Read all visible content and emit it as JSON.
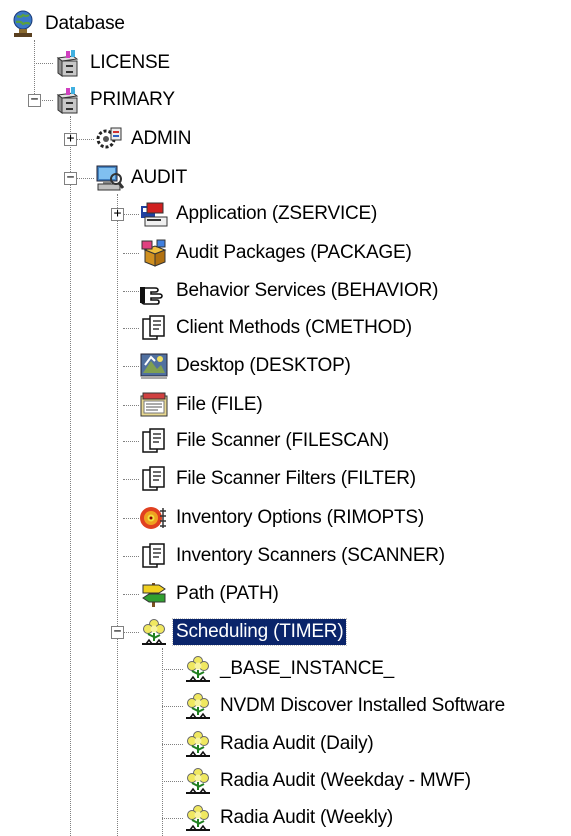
{
  "tree": {
    "root": {
      "label": "Database",
      "icon": "database-globe-icon"
    },
    "license": {
      "label": "LICENSE",
      "icon": "file-cabinet-icon"
    },
    "primary": {
      "label": "PRIMARY",
      "icon": "file-cabinet-icon",
      "expander": "−"
    },
    "admin": {
      "label": "ADMIN",
      "icon": "admin-gear-icon",
      "expander": "+"
    },
    "audit": {
      "label": "AUDIT",
      "icon": "audit-computer-icon",
      "expander": "−"
    },
    "audit_children": [
      {
        "label": "Application (ZSERVICE)",
        "icon": "application-icon",
        "expander": "+"
      },
      {
        "label": "Audit Packages (PACKAGE)",
        "icon": "package-icon"
      },
      {
        "label": "Behavior Services (BEHAVIOR)",
        "icon": "pointing-hand-icon"
      },
      {
        "label": "Client Methods (CMETHOD)",
        "icon": "class-document-icon"
      },
      {
        "label": "Desktop (DESKTOP)",
        "icon": "desktop-icon"
      },
      {
        "label": "File (FILE)",
        "icon": "file-icon"
      },
      {
        "label": "File Scanner (FILESCAN)",
        "icon": "class-document-icon"
      },
      {
        "label": "File Scanner Filters (FILTER)",
        "icon": "class-document-icon"
      },
      {
        "label": "Inventory Options (RIMOPTS)",
        "icon": "inventory-options-icon"
      },
      {
        "label": "Inventory Scanners (SCANNER)",
        "icon": "class-document-icon"
      },
      {
        "label": "Path (PATH)",
        "icon": "path-signpost-icon"
      },
      {
        "label": "Scheduling (TIMER)",
        "icon": "timer-flower-icon",
        "expander": "−",
        "selected": true
      }
    ],
    "timer_children": [
      {
        "label": "_BASE_INSTANCE_",
        "icon": "timer-flower-icon"
      },
      {
        "label": "NVDM Discover Installed Software",
        "icon": "timer-flower-icon"
      },
      {
        "label": "Radia Audit (Daily)",
        "icon": "timer-flower-icon"
      },
      {
        "label": "Radia Audit (Weekday - MWF)",
        "icon": "timer-flower-icon"
      },
      {
        "label": "Radia Audit (Weekly)",
        "icon": "timer-flower-icon"
      }
    ],
    "colors": {
      "selection": "#0a246a",
      "tree_lines": "#808080"
    }
  }
}
